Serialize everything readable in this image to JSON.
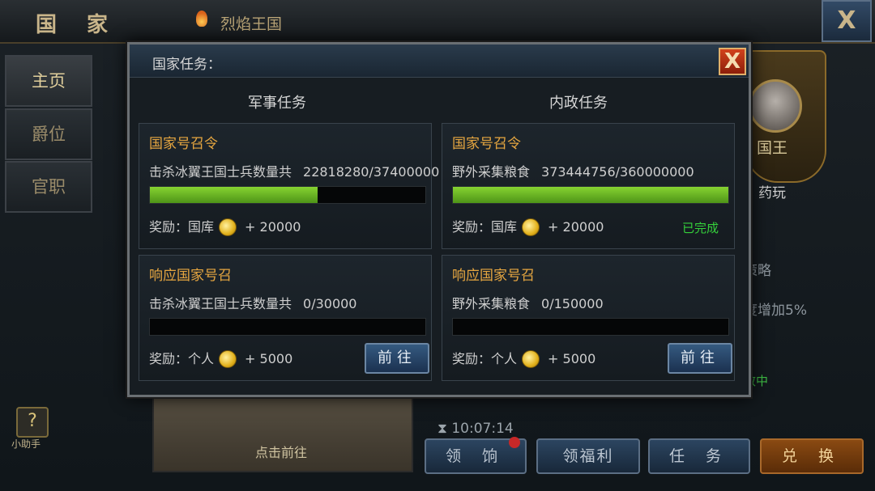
{
  "background": {
    "title": "国 家",
    "kingdom": "烈焰王国",
    "close_label": "X",
    "side_tabs": [
      "主页",
      "爵位",
      "官职"
    ],
    "helper_label": "小助手",
    "helper_icon": "?",
    "map_label": "点击前往",
    "timer": "10:07:14",
    "bottom_buttons": [
      "领 饷",
      "领福利",
      "任 务",
      "兑 换"
    ],
    "king_label": "国王",
    "king_name": "药玩",
    "right_text_top": "策略",
    "right_text": "度增加5%",
    "right_chip": "效中"
  },
  "dialog": {
    "title": "国家任务：",
    "close_label": "X",
    "columns": [
      {
        "title": "军事任务",
        "cards": [
          {
            "title": "国家号召令",
            "desc": "击杀冰翼王国士兵数量共",
            "count": "22818280/37400000",
            "progress": 0.61,
            "reward_label": "奖励：",
            "reward_target": "国库",
            "reward_amount": "+ 20000",
            "status": "",
            "button": ""
          },
          {
            "title": "响应国家号召",
            "desc": "击杀冰翼王国士兵数量共",
            "count": "0/30000",
            "progress": 0,
            "reward_label": "奖励：",
            "reward_target": "个人",
            "reward_amount": "+ 5000",
            "status": "",
            "button": "前往"
          }
        ]
      },
      {
        "title": "内政任务",
        "cards": [
          {
            "title": "国家号召令",
            "desc": "野外采集粮食",
            "count": "373444756/360000000",
            "progress": 1.0,
            "reward_label": "奖励：",
            "reward_target": "国库",
            "reward_amount": "+ 20000",
            "status": "已完成",
            "button": ""
          },
          {
            "title": "响应国家号召",
            "desc": "野外采集粮食",
            "count": "0/150000",
            "progress": 0,
            "reward_label": "奖励：",
            "reward_target": "个人",
            "reward_amount": "+ 5000",
            "status": "",
            "button": "前往"
          }
        ]
      }
    ]
  },
  "colors": {
    "accent_gold": "#e6a640",
    "progress_green": "#6fbf25",
    "complete_green": "#35d03b",
    "close_red": "#c53a18"
  }
}
